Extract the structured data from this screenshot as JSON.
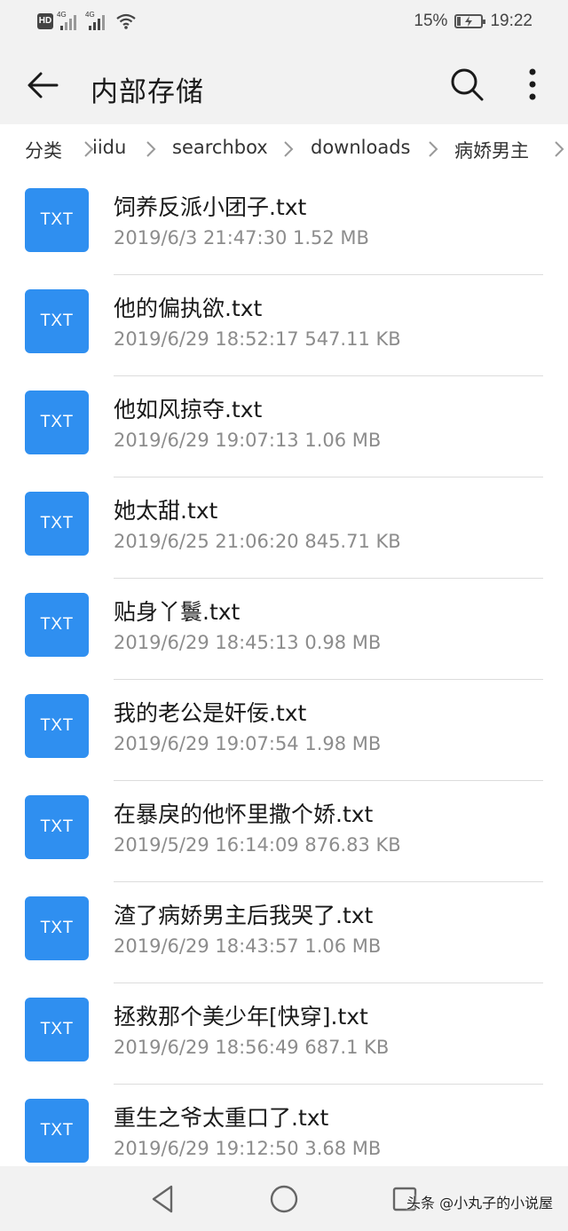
{
  "status_bar": {
    "hd": "HD",
    "signal1_label": "4G",
    "signal2_label": "4G",
    "battery_percent": "15%",
    "battery_level": 0.15,
    "time": "19:22"
  },
  "app_bar": {
    "title": "内部存储",
    "back_icon": "arrow-left-icon",
    "search_icon": "search-icon",
    "more_icon": "more-vertical-icon"
  },
  "breadcrumb": {
    "items": [
      "分类",
      "iidu",
      "searchbox",
      "downloads",
      "病娇男主"
    ]
  },
  "files": [
    {
      "type": "TXT",
      "name": "饲养反派小团子.txt",
      "meta": "2019/6/3 21:47:30 1.52 MB"
    },
    {
      "type": "TXT",
      "name": "他的偏执欲.txt",
      "meta": "2019/6/29 18:52:17 547.11 KB"
    },
    {
      "type": "TXT",
      "name": "他如风掠夺.txt",
      "meta": "2019/6/29 19:07:13 1.06 MB"
    },
    {
      "type": "TXT",
      "name": "她太甜.txt",
      "meta": "2019/6/25 21:06:20 845.71 KB"
    },
    {
      "type": "TXT",
      "name": "贴身丫鬟.txt",
      "meta": "2019/6/29 18:45:13 0.98 MB"
    },
    {
      "type": "TXT",
      "name": "我的老公是奸佞.txt",
      "meta": "2019/6/29 19:07:54 1.98 MB"
    },
    {
      "type": "TXT",
      "name": "在暴戾的他怀里撒个娇.txt",
      "meta": "2019/5/29 16:14:09 876.83 KB"
    },
    {
      "type": "TXT",
      "name": "渣了病娇男主后我哭了.txt",
      "meta": "2019/6/29 18:43:57 1.06 MB"
    },
    {
      "type": "TXT",
      "name": "拯救那个美少年[快穿].txt",
      "meta": "2019/6/29 18:56:49 687.1 KB"
    },
    {
      "type": "TXT",
      "name": "重生之爷太重口了.txt",
      "meta": "2019/6/29 19:12:50 3.68 MB"
    }
  ],
  "nav_bar": {
    "back_icon": "triangle-back-icon",
    "home_icon": "circle-home-icon",
    "recent_icon": "square-recents-icon"
  },
  "watermark": "头条 @小丸子的小说屋",
  "colors": {
    "accent": "#2f8ff0",
    "bar_background": "#f2f2f2",
    "meta_text": "#8c8c8c"
  }
}
